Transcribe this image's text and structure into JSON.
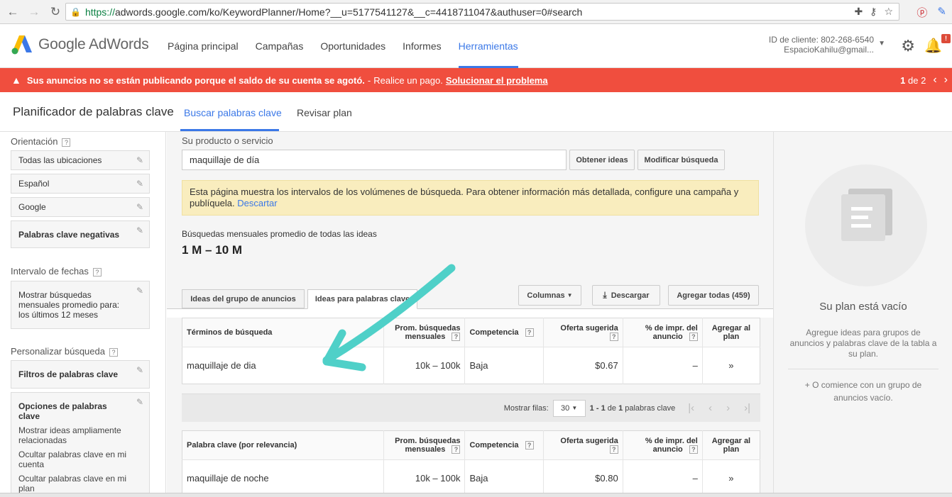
{
  "browser": {
    "url_https": "https://",
    "url_rest": "adwords.google.com/ko/KeywordPlanner/Home?__u=5177541127&__c=4418711047&authuser=0#search"
  },
  "header": {
    "logo_text": "Google AdWords",
    "nav": [
      "Página principal",
      "Campañas",
      "Oportunidades",
      "Informes",
      "Herramientas"
    ],
    "active_nav": "Herramientas",
    "client_id": "ID de cliente: 802-268-6540",
    "email": "EspacioKahilu@gmail...",
    "notification_badge": "!"
  },
  "alert": {
    "bold_text": "Sus anuncios no se están publicando porque el saldo de su cuenta se agotó.",
    "sep": "-",
    "text": "Realice un pago.",
    "link": "Solucionar el problema",
    "page_current": "1",
    "page_label": "de 2"
  },
  "subheader": {
    "title": "Planificador de palabras clave",
    "tab_search": "Buscar palabras clave",
    "tab_review": "Revisar plan"
  },
  "sidebar": {
    "targeting_label": "Orientación",
    "targeting_items": [
      "Todas las ubicaciones",
      "Español",
      "Google"
    ],
    "negative_keywords": "Palabras clave negativas",
    "date_range_label": "Intervalo de fechas",
    "date_range_value": "Mostrar búsquedas mensuales promedio para: los últimos 12 meses",
    "customize_label": "Personalizar búsqueda",
    "keyword_filters": "Filtros de palabras clave",
    "keyword_options": "Opciones de palabras clave",
    "options": [
      "Mostrar ideas ampliamente relacionadas",
      "Ocultar palabras clave en mi cuenta",
      "Ocultar palabras clave en mi plan"
    ]
  },
  "main": {
    "product_label": "Su producto o servicio",
    "product_value": "maquillaje de día",
    "get_ideas_button": "Obtener ideas",
    "modify_search_button": "Modificar búsqueda",
    "notice_text": "Esta página muestra los intervalos de los volúmenes de búsqueda. Para obtener información más detallada, configure una campaña y publíquela.",
    "notice_link": "Descartar",
    "avg_label": "Búsquedas mensuales promedio de todas las ideas",
    "avg_value": "1 M – 10 M",
    "tab_adgroups": "Ideas del grupo de anuncios",
    "tab_keywords": "Ideas para palabras clave",
    "columns_button": "Columnas",
    "download_button": "Descargar",
    "add_all_button": "Agregar todas (459)",
    "search_terms_table": {
      "headers": [
        "Términos de búsqueda",
        "Prom. búsquedas mensuales",
        "Competencia",
        "Oferta sugerida",
        "% de impr. del anuncio",
        "Agregar al plan"
      ],
      "rows": [
        {
          "term": "maquillaje de dia",
          "searches": "10k – 100k",
          "competition": "Baja",
          "bid": "$0.67",
          "impr": "–",
          "add": "»"
        }
      ]
    },
    "pager": {
      "show_rows_label": "Mostrar filas:",
      "rows_value": "30",
      "range_prefix": "1 - 1",
      "range_of": "de",
      "range_total": "1",
      "range_suffix": "palabras clave"
    },
    "keyword_table": {
      "headers": [
        "Palabra clave (por relevancia)",
        "Prom. búsquedas mensuales",
        "Competencia",
        "Oferta sugerida",
        "% de impr. del anuncio",
        "Agregar al plan"
      ],
      "rows": [
        {
          "term": "maquillaje de noche",
          "searches": "10k – 100k",
          "competition": "Baja",
          "bid": "$0.80",
          "impr": "–",
          "add": "»"
        }
      ]
    }
  },
  "plan_panel": {
    "title": "Su plan está vacío",
    "desc": "Agregue ideas para grupos de anuncios y palabras clave de la tabla a su plan.",
    "alt": "+ O comience con un grupo de anuncios vacío."
  },
  "colors": {
    "accent": "#3b78e7",
    "alert": "#f04e3e",
    "notice_bg": "#f9edbe",
    "annotation_arrow": "#4fd0c8"
  }
}
